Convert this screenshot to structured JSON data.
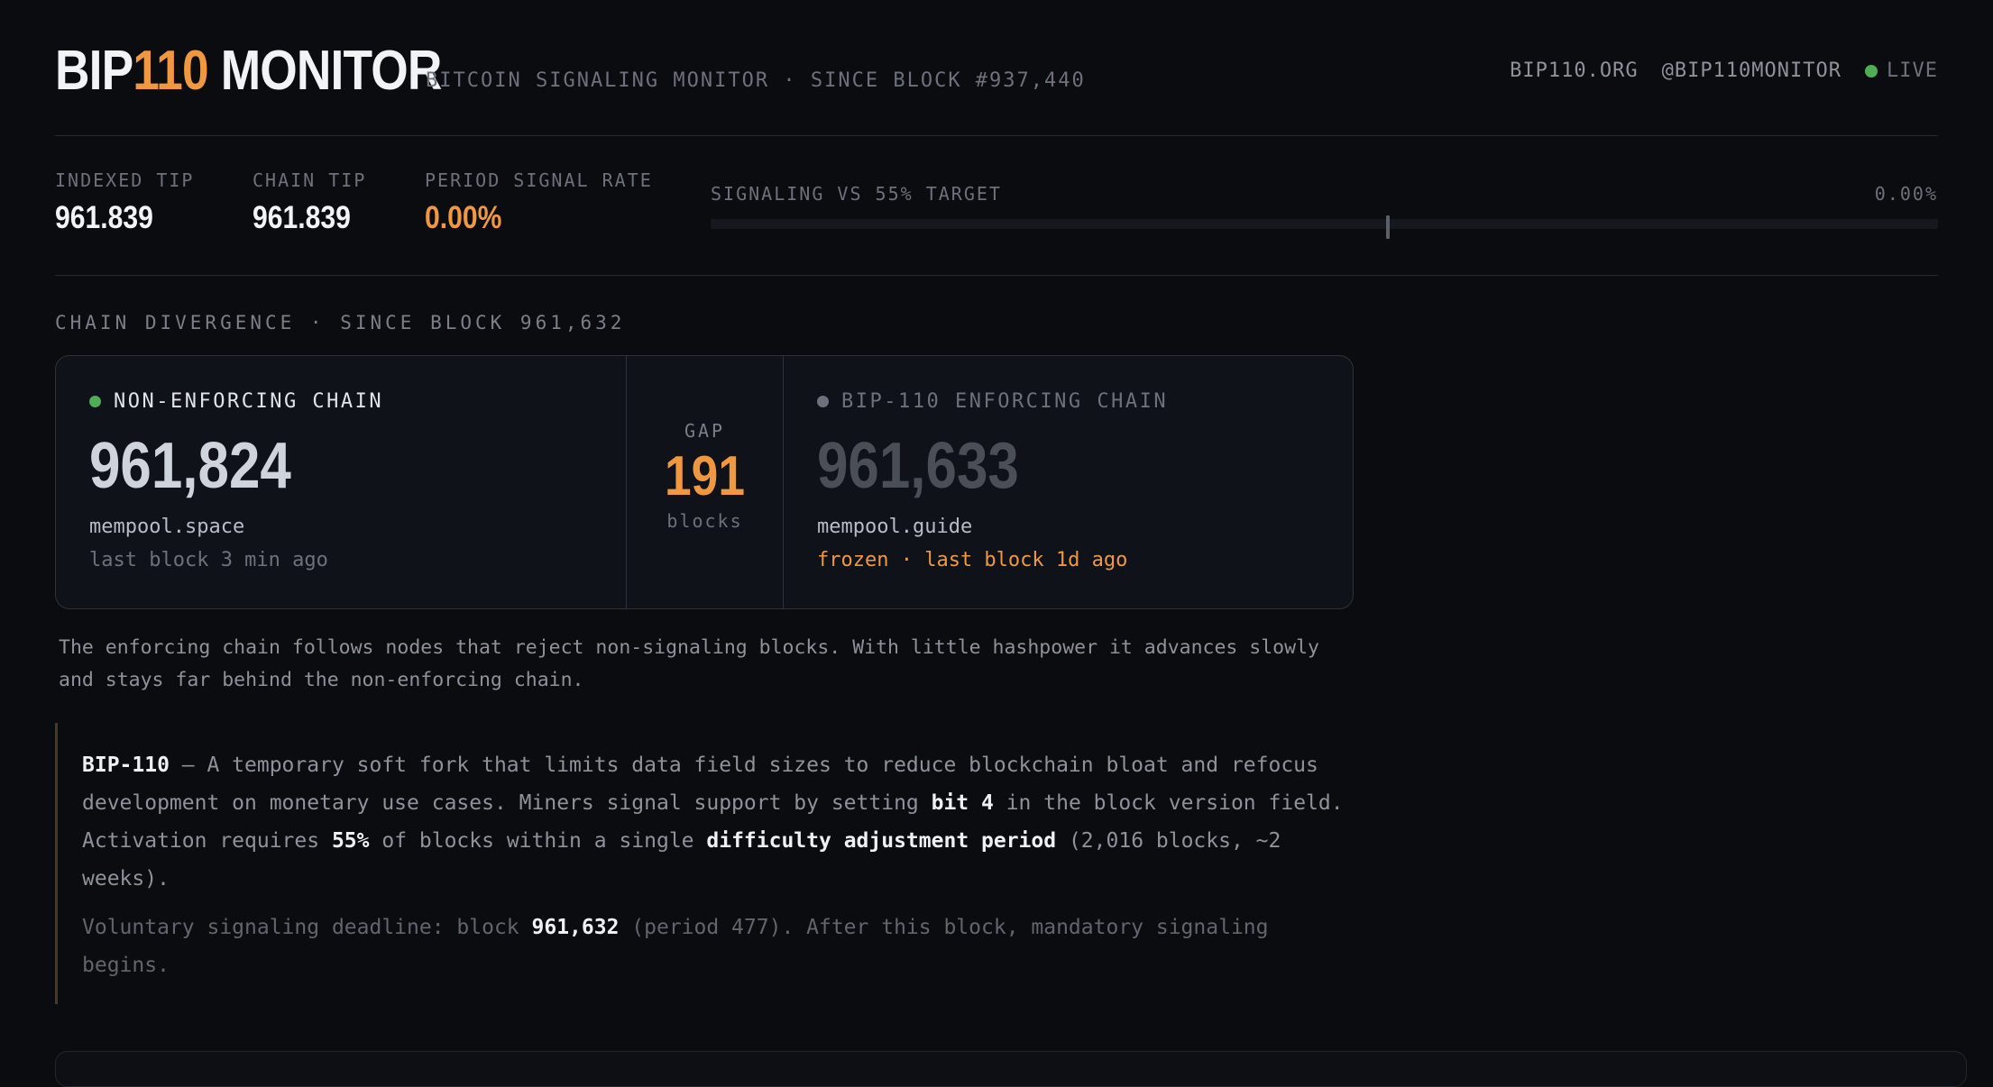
{
  "header": {
    "logo_prefix": "BIP",
    "logo_accent": "110",
    "logo_suffix": " MONITOR",
    "tagline": "BITCOIN SIGNALING MONITOR · SINCE BLOCK #937,440",
    "links": [
      "BIP110.ORG",
      "@BIP110MONITOR"
    ],
    "live_label": "LIVE"
  },
  "stats": {
    "indexed_tip_label": "INDEXED TIP",
    "indexed_tip_value": "961.839",
    "chain_tip_label": "CHAIN TIP",
    "chain_tip_value": "961.839",
    "signal_rate_label": "PERIOD SIGNAL RATE",
    "signal_rate_value": "0.00%",
    "target_label": "SIGNALING VS 55% TARGET",
    "target_value": "0.00%",
    "target_fraction": 0.0,
    "target_threshold": 0.55
  },
  "divergence": {
    "section_label": "CHAIN DIVERGENCE · SINCE BLOCK 961,632",
    "left": {
      "title": "NON-ENFORCING CHAIN",
      "height": "961,824",
      "source": "mempool.space",
      "status": "last block 3 min ago"
    },
    "gap": {
      "label": "GAP",
      "value": "191",
      "unit": "blocks"
    },
    "right": {
      "title": "BIP-110 ENFORCING CHAIN",
      "height": "961,633",
      "source": "mempool.guide",
      "status": "frozen · last block 1d ago"
    },
    "explanation": "The enforcing chain follows nodes that reject non-signaling blocks. With little hashpower it advances slowly and stays far behind the non-enforcing chain."
  },
  "info": {
    "p1_term": "BIP-110",
    "p1_a": " — A temporary soft fork that limits data field sizes to reduce blockchain bloat and refocus development on monetary use cases. Miners signal support by setting ",
    "p1_bit": "bit 4",
    "p1_b": " in the block version field. Activation requires ",
    "p1_pct": "55%",
    "p1_c": " of blocks within a single ",
    "p1_period": "difficulty adjustment period",
    "p1_d": " (2,016 blocks, ~2 weeks).",
    "p2_a": "Voluntary signaling deadline: block ",
    "p2_block": "961,632",
    "p2_b": " (period 477). After this block, mandatory signaling begins."
  },
  "colors": {
    "accent": "#f0983f",
    "live": "#4eae56",
    "background": "#0b0c10"
  }
}
